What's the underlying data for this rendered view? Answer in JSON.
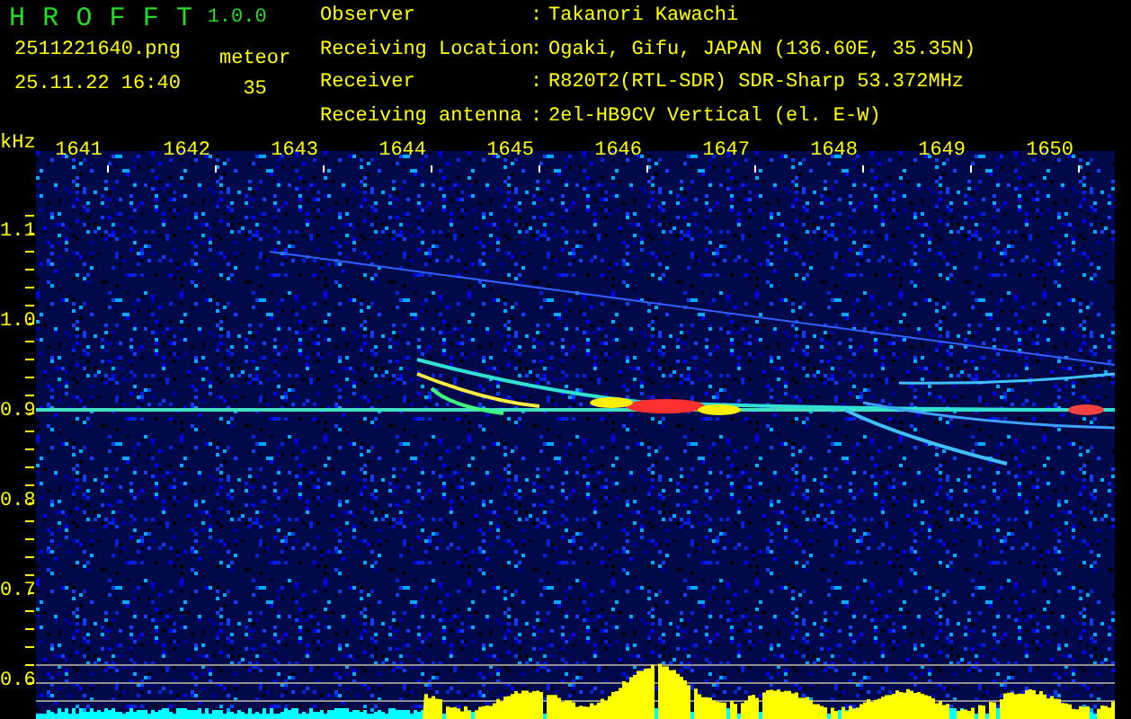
{
  "app": {
    "title": "H R O F F T",
    "version": "1.0.0",
    "file_name": "2511221640.png",
    "timestamp": "25.11.22 16:40",
    "count_label": "meteor",
    "count": "35"
  },
  "info": [
    {
      "label": "Observer",
      "separator": ":",
      "value": "Takanori Kawachi"
    },
    {
      "label": "Receiving Location",
      "separator": ":",
      "value": "Ogaki, Gifu, JAPAN (136.60E, 35.35N)"
    },
    {
      "label": "Receiver",
      "separator": ":",
      "value": "R820T2(RTL-SDR) SDR-Sharp 53.372MHz"
    },
    {
      "label": "Receiving antenna",
      "separator": ":",
      "value": "2el-HB9CV Vertical (el. E-W)"
    }
  ],
  "spectrogram": {
    "unit": "kHz",
    "x_ticks": [
      "1641",
      "1642",
      "1643",
      "1644",
      "1645",
      "1646",
      "1647",
      "1648",
      "1649",
      "1650"
    ],
    "y_ticks": [
      "1.1",
      "1.0",
      "0.9",
      "0.8",
      "0.7",
      "0.6"
    ]
  }
}
